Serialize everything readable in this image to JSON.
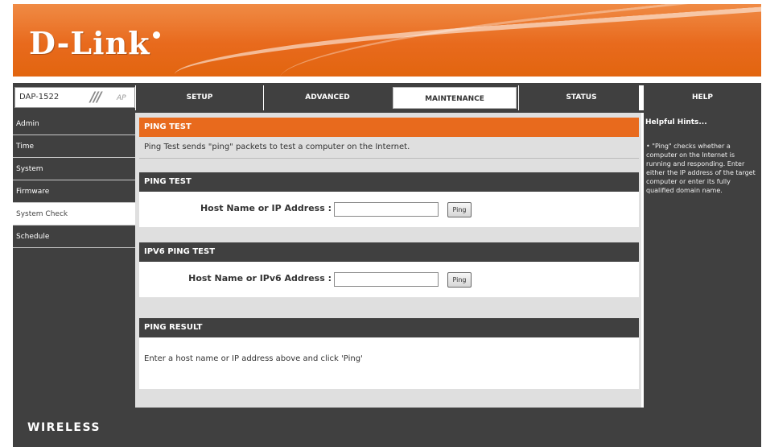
{
  "brand": {
    "logo_text": "D-Link"
  },
  "model": {
    "name": "DAP-1522",
    "badge": "AP"
  },
  "nav": {
    "tabs": [
      {
        "label": "SETUP"
      },
      {
        "label": "ADVANCED"
      },
      {
        "label": "MAINTENANCE"
      },
      {
        "label": "STATUS"
      },
      {
        "label": "HELP"
      }
    ],
    "active_tab": "MAINTENANCE"
  },
  "sidebar": {
    "items": [
      {
        "label": "Admin"
      },
      {
        "label": "Time"
      },
      {
        "label": "System"
      },
      {
        "label": "Firmware"
      },
      {
        "label": "System Check"
      },
      {
        "label": "Schedule"
      }
    ],
    "active_item": "System Check"
  },
  "ping_header": {
    "title": "PING TEST",
    "description": "Ping Test sends \"ping\" packets to test a computer on the Internet."
  },
  "ping_test": {
    "title": "PING TEST",
    "host_label": "Host Name or IP Address :",
    "host_value": "",
    "button_label": "Ping"
  },
  "ipv6_ping_test": {
    "title": "IPV6 PING TEST",
    "host_label": "Host Name or IPv6 Address :",
    "host_value": "",
    "button_label": "Ping"
  },
  "ping_result": {
    "title": "PING RESULT",
    "message": "Enter a host name or IP address above and click 'Ping'"
  },
  "help": {
    "title": "Helpful Hints...",
    "text": "• \"Ping\" checks whether a computer on the Internet is running and responding. Enter either the IP address of the target computer or enter its fully qualified domain name."
  },
  "footer": {
    "label": "WIRELESS"
  },
  "colors": {
    "accent": "#e86a1d",
    "dark": "#404040",
    "panel_bg": "#dfdfdf"
  }
}
